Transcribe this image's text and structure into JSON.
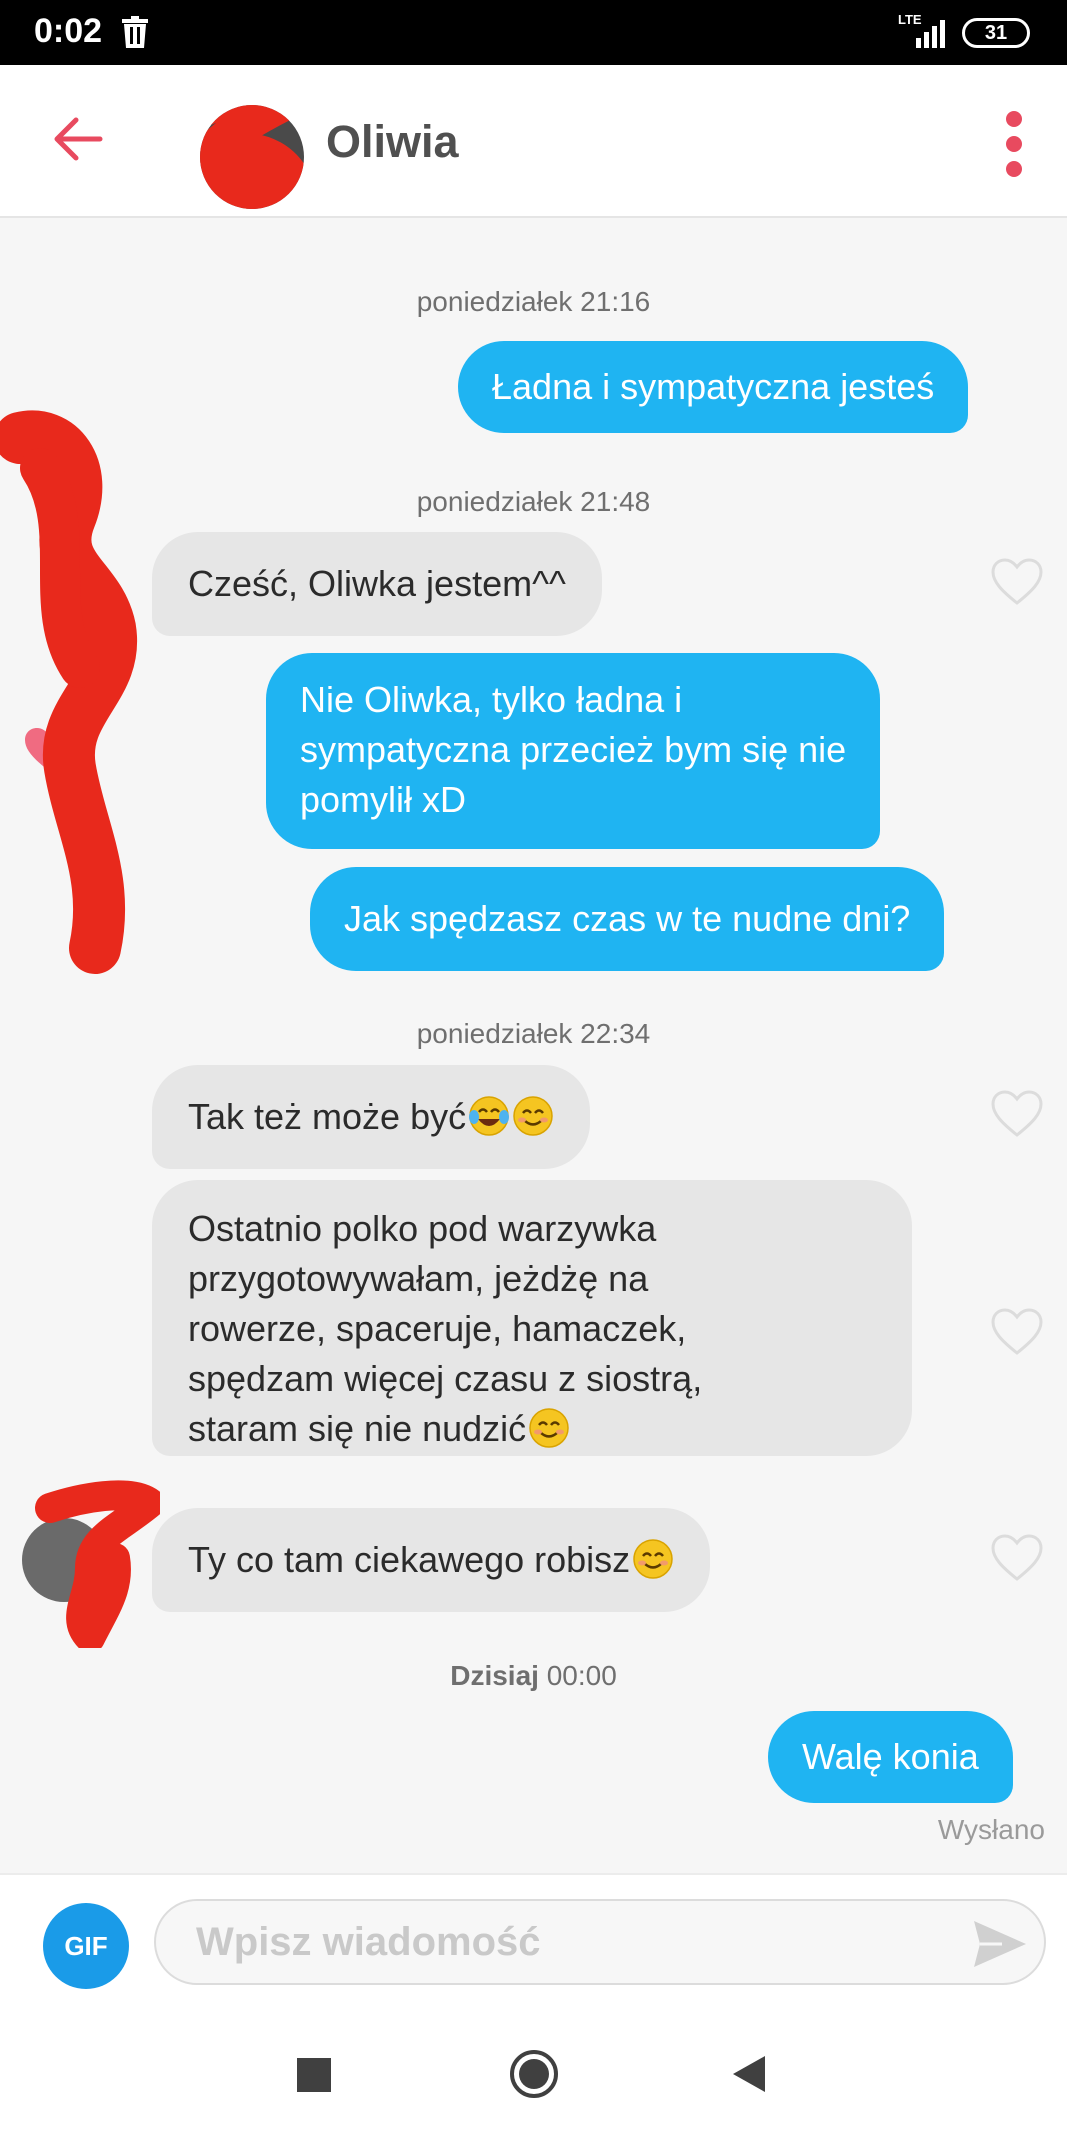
{
  "status_bar": {
    "time": "0:02",
    "network": "LTE",
    "battery": "31"
  },
  "header": {
    "contact_name": "Oliwia"
  },
  "messages": [
    {
      "timestamp": "poniedziałek 21:16"
    },
    {
      "direction": "out",
      "lines": [
        "Ładna i sympatyczna jesteś"
      ]
    },
    {
      "timestamp": "poniedziałek 21:48"
    },
    {
      "direction": "in",
      "lines": [
        "Cześć, Oliwka jestem^^"
      ]
    },
    {
      "direction": "out",
      "lines": [
        "Nie Oliwka, tylko ładna i",
        "sympatyczna przecież bym się nie",
        "pomylił xD"
      ]
    },
    {
      "direction": "out",
      "lines": [
        "Jak spędzasz czas w te nudne dni?"
      ]
    },
    {
      "timestamp": "poniedziałek 22:34"
    },
    {
      "direction": "in",
      "lines": [
        "Tak też może być"
      ],
      "emojis": [
        "face-with-tears-of-joy",
        "smiling-face"
      ]
    },
    {
      "direction": "in",
      "lines": [
        "Ostatnio polko pod warzywka",
        "przygotowywałam, jeżdżę na",
        "rowerze, spaceruje, hamaczek,",
        "spędzam więcej czasu z siostrą,",
        "staram się nie nudzić"
      ],
      "emojis": [
        "smiling-face"
      ]
    },
    {
      "direction": "in",
      "lines": [
        "Ty co tam ciekawego robisz"
      ],
      "emojis": [
        "smiling-face"
      ]
    },
    {
      "timestamp_bold": "Dzisiaj",
      "timestamp": "00:00"
    },
    {
      "direction": "out",
      "lines": [
        "Walę konia"
      ],
      "status": "Wysłano"
    }
  ],
  "composer": {
    "gif_label": "GIF",
    "placeholder": "Wpisz wiadomość"
  },
  "colors": {
    "accent": "#e84a5f",
    "outgoing": "#1fb4f2",
    "incoming": "#e6e6e6",
    "gif": "#1a9be8",
    "liked_heart": "#f06b81"
  }
}
